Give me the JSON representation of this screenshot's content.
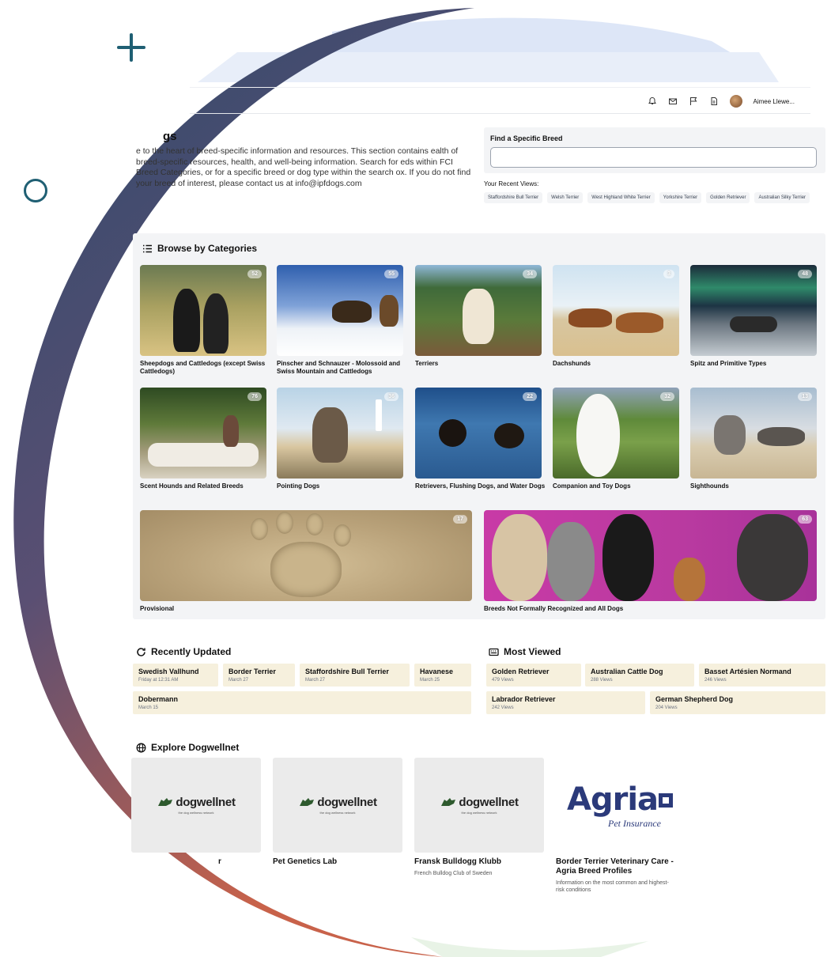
{
  "colors": {
    "accent": "#1f5f73",
    "panel": "#f3f4f6",
    "tile": "#f6f0dd",
    "arc_top": "#2f4a6b",
    "arc_bottom": "#c8624a"
  },
  "topbar": {
    "icons": [
      "bell-icon",
      "mail-icon",
      "flag-icon",
      "document-icon"
    ],
    "user_name": "Aimee Llewe..."
  },
  "intro": {
    "heading": "gs",
    "text": "e to the heart of breed-specific information and resources. This section contains ealth of breed-specific resources, health, and well-being information. Search for eds within FCI Breed Categories, or for a specific breed or dog type within the search ox. If you do not find your breed of interest, please contact us at info@ipfdogs.com"
  },
  "search": {
    "label": "Find a Specific Breed",
    "value": "",
    "recent_label": "Your Recent Views:",
    "recent": [
      "Staffordshire Bull Terrier",
      "Welsh Terrier",
      "West Highland White Terrier",
      "Yorkshire Terrier",
      "Golden Retriever",
      "Australian Silky Terrier"
    ]
  },
  "browse": {
    "title": "Browse by Categories",
    "categories": [
      {
        "name": "Sheepdogs and Cattledogs (except Swiss Cattledogs)",
        "count": "52"
      },
      {
        "name": "Pinscher and Schnauzer - Molossoid and Swiss Mountain and Cattledogs",
        "count": "55"
      },
      {
        "name": "Terriers",
        "count": "34"
      },
      {
        "name": "Dachshunds",
        "count": "3"
      },
      {
        "name": "Spitz and Primitive Types",
        "count": "48"
      },
      {
        "name": "Scent Hounds and Related Breeds",
        "count": "76"
      },
      {
        "name": "Pointing Dogs",
        "count": "36"
      },
      {
        "name": "Retrievers, Flushing Dogs, and Water Dogs",
        "count": "22"
      },
      {
        "name": "Companion and Toy Dogs",
        "count": "32"
      },
      {
        "name": "Sighthounds",
        "count": "13"
      },
      {
        "name": "Provisional",
        "count": "17"
      },
      {
        "name": "Breeds Not Formally Recognized and All Dogs",
        "count": "63"
      }
    ]
  },
  "recently_updated": {
    "title": "Recently Updated",
    "items": [
      {
        "name": "Swedish Vallhund",
        "date": "Friday at 12:31 AM"
      },
      {
        "name": "Border Terrier",
        "date": "March 27"
      },
      {
        "name": "Staffordshire Bull Terrier",
        "date": "March 27"
      },
      {
        "name": "Havanese",
        "date": "March 25"
      },
      {
        "name": "Dobermann",
        "date": "March 15"
      }
    ]
  },
  "most_viewed": {
    "title": "Most Viewed",
    "items": [
      {
        "name": "Golden Retriever",
        "views": "479 Views"
      },
      {
        "name": "Australian Cattle Dog",
        "views": "288 Views"
      },
      {
        "name": "Basset Artésien Normand",
        "views": "246 Views"
      },
      {
        "name": "Labrador Retriever",
        "views": "242 Views"
      },
      {
        "name": "German Shepherd Dog",
        "views": "204 Views"
      }
    ]
  },
  "explore": {
    "title": "Explore Dogwellnet",
    "logo_text": "dogwellnet",
    "logo_tagline": "the dog wellness network",
    "agria_word": "Agria",
    "agria_sub": "Pet Insurance",
    "cards": [
      {
        "name": "r",
        "desc": ""
      },
      {
        "name": "Pet Genetics Lab",
        "desc": ""
      },
      {
        "name": "Fransk Bulldogg Klubb",
        "desc": "French Bulldog Club of Sweden"
      },
      {
        "name": "Border Terrier Veterinary Care - Agria Breed Profiles",
        "desc": "Information on the most common and highest-risk conditions"
      }
    ]
  }
}
